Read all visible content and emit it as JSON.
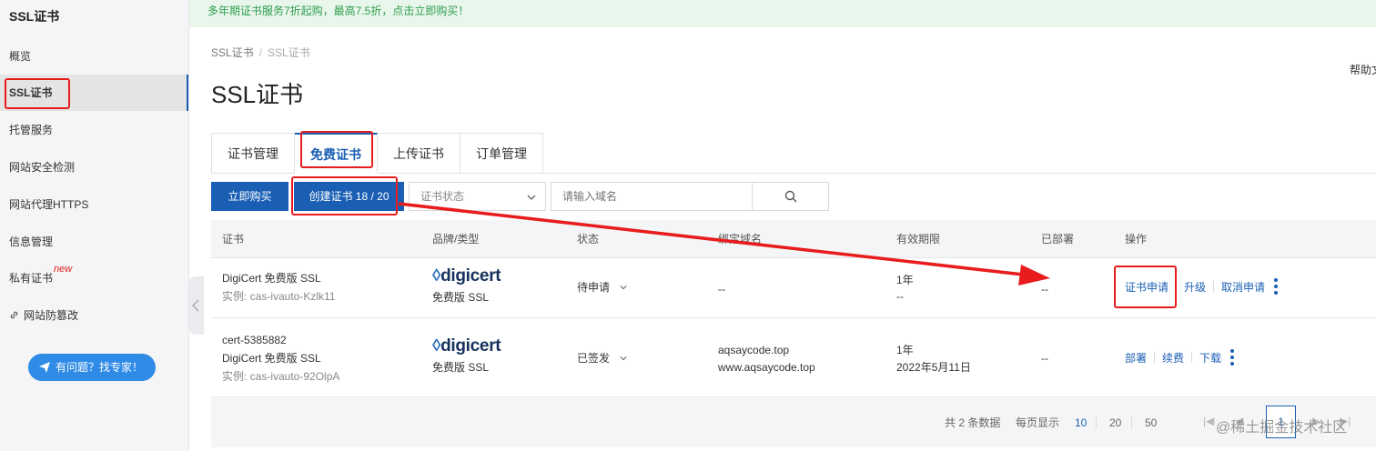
{
  "sidebar": {
    "title": "SSL证书",
    "items": [
      {
        "label": "概览"
      },
      {
        "label": "SSL证书"
      },
      {
        "label": "托管服务"
      },
      {
        "label": "网站安全检测"
      },
      {
        "label": "网站代理HTTPS"
      },
      {
        "label": "信息管理"
      },
      {
        "label": "私有证书"
      },
      {
        "label": "网站防篡改"
      }
    ],
    "new_badge": "new",
    "help_button": "有问题？找专家！"
  },
  "banner": {
    "text": "多年期证书服务7折起购，最高7.5折，点击立即购买！"
  },
  "breadcrumb": [
    "SSL证书",
    "SSL证书"
  ],
  "help_doc": "帮助文",
  "page_title": "SSL证书",
  "tabs": [
    {
      "label": "证书管理"
    },
    {
      "label": "免费证书"
    },
    {
      "label": "上传证书"
    },
    {
      "label": "订单管理"
    }
  ],
  "toolbar": {
    "buy_button": "立即购买",
    "create_button": "创建证书 18 / 20",
    "status_select": "证书状态",
    "search_placeholder": "请输入域名"
  },
  "table": {
    "headers": [
      "证书",
      "品牌/类型",
      "状态",
      "绑定域名",
      "有效期限",
      "已部署",
      "操作"
    ],
    "rows": [
      {
        "cert_name": "DigiCert 免费版 SSL",
        "instance": "实例: cas-ivauto-Kzlk11",
        "brand_logo": "digicert",
        "brand_type": "免费版 SSL",
        "status": "待申请",
        "domain": "--",
        "validity": "1年",
        "validity_date": "--",
        "deployed": "--",
        "actions": [
          "证书申请",
          "升级",
          "取消申请"
        ]
      },
      {
        "cert_id": "cert-5385882",
        "cert_name": "DigiCert 免费版 SSL",
        "instance": "实例: cas-ivauto-92OlpA",
        "brand_logo": "digicert",
        "brand_type": "免费版 SSL",
        "status": "已签发",
        "domain1": "aqsaycode.top",
        "domain2": "www.aqsaycode.top",
        "validity": "1年",
        "validity_date": "2022年5月11日",
        "deployed": "--",
        "actions": [
          "部署",
          "续费",
          "下载"
        ]
      }
    ]
  },
  "pagination": {
    "total": "共 2 条数据",
    "per_page_label": "每页显示",
    "sizes": [
      "10",
      "20",
      "50"
    ],
    "current_page": "1"
  },
  "watermark": "@稀土掘金技术社区",
  "colors": {
    "primary": "#1a5fb4",
    "annotation": "#e81c1c",
    "banner_text": "#2e9e4c"
  }
}
